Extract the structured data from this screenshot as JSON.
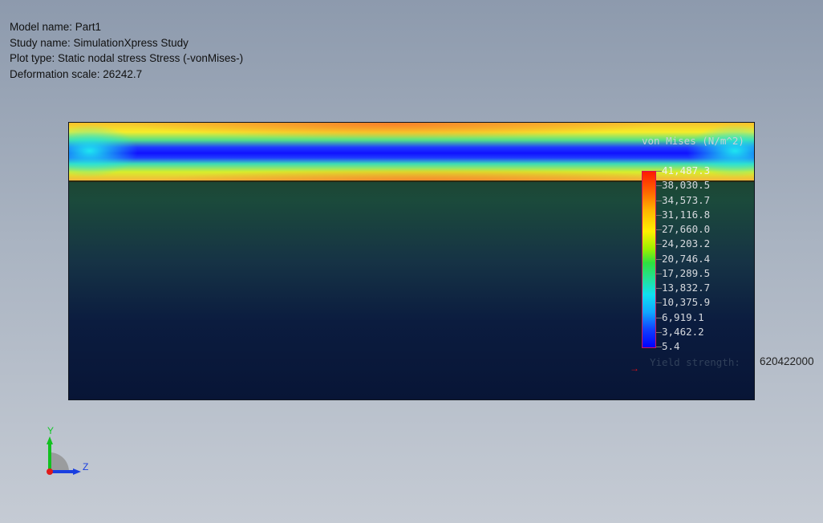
{
  "info": {
    "model_name": "Model name: Part1",
    "study_name": "Study name: SimulationXpress Study",
    "plot_type": "Plot type: Static nodal stress Stress (-vonMises-)",
    "deformation_scale": "Deformation scale: 26242.7"
  },
  "legend": {
    "title": "von Mises (N/m^2)",
    "labels": [
      "41,487.3",
      "38,030.5",
      "34,573.7",
      "31,116.8",
      "27,660.0",
      "24,203.2",
      "20,746.4",
      "17,289.5",
      "13,832.7",
      "10,375.9",
      "6,919.1",
      "3,462.2",
      "5.4"
    ],
    "yield_label": "Yield strength:",
    "yield_value": "620422000"
  },
  "triad": {
    "y_label": "Y",
    "z_label": "Z"
  }
}
